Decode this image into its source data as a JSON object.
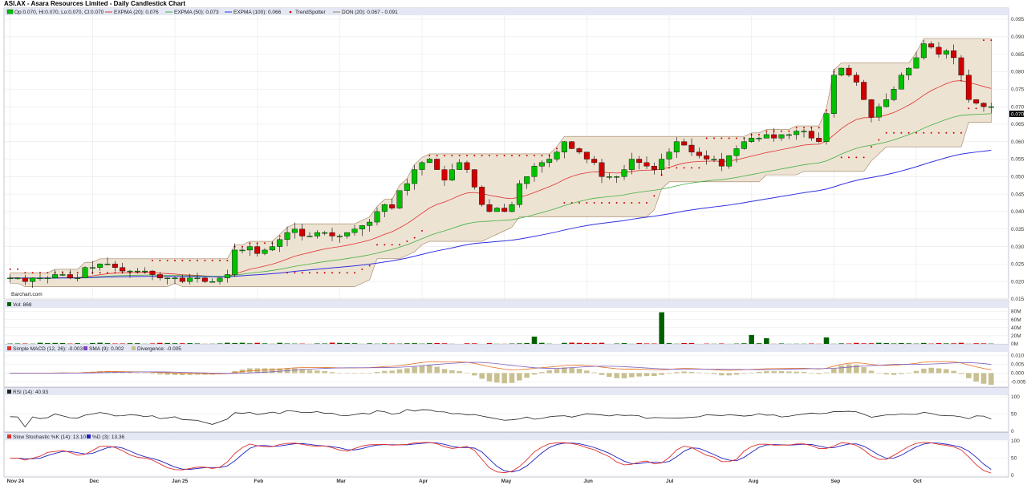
{
  "title": "ASI.AX - Asara Resources Limited - Daily Candlestick Chart",
  "watermark": "Barchart.com",
  "colors": {
    "up": "#00c000",
    "down": "#d00000",
    "ema20": "#e03030",
    "ema50": "#40b040",
    "ema100": "#3030e0",
    "donchian": "#a08060",
    "donchianFill": "#ede3d3",
    "trendspotter": "#d00000",
    "header": "#e4e8f4",
    "grid": "#e8e8e8"
  },
  "price_panel": {
    "legend": [
      {
        "key": "ohlc",
        "text": "Op:0.070, Hi:0.070, Lo:0.070, Cl:0.070"
      },
      {
        "key": "ema20",
        "text": "EXPMA (20): 0.076"
      },
      {
        "key": "ema50",
        "text": "EXPMA (50): 0.073"
      },
      {
        "key": "ema100",
        "text": "EXPMA (100): 0.066"
      },
      {
        "key": "trend",
        "text": "TrendSpotter"
      },
      {
        "key": "don",
        "text": "DON (20): 0.067 - 0.091"
      }
    ],
    "y_ticks": [
      "0.015",
      "0.020",
      "0.025",
      "0.030",
      "0.035",
      "0.040",
      "0.045",
      "0.050",
      "0.055",
      "0.060",
      "0.065",
      "0.070",
      "0.075",
      "0.080",
      "0.085",
      "0.090",
      "0.095"
    ],
    "last_price_label": "0.070"
  },
  "volume_panel": {
    "legend": "Vol: 868",
    "y_ticks": [
      "0M",
      "20M",
      "40M",
      "60M",
      "80M"
    ]
  },
  "macd_panel": {
    "legend": [
      {
        "key": "macd",
        "text": "Simple MACD (12, 26): -0.003"
      },
      {
        "key": "sma",
        "text": "SMA (9): 0.002"
      },
      {
        "key": "div",
        "text": "Divergence: -0.005"
      }
    ],
    "y_ticks": [
      "-0.005",
      "0.000",
      "0.005",
      "0.010"
    ]
  },
  "rsi_panel": {
    "legend": "RSI (14): 40.93",
    "y_ticks": [
      "0",
      "50",
      "100"
    ]
  },
  "stoch_panel": {
    "legend": [
      {
        "key": "k",
        "text": "Slow Stochastic %K (14): 13.10"
      },
      {
        "key": "d",
        "text": "%D (3): 13.36"
      }
    ],
    "y_ticks": [
      "0",
      "50",
      "100"
    ]
  },
  "x_months": [
    "Nov 24",
    "Dec",
    "Jan 25",
    "Feb",
    "Mar",
    "Apr",
    "May",
    "Jun",
    "Jul",
    "Aug",
    "Sep",
    "Oct"
  ],
  "chart_data": {
    "type": "candlestick",
    "x_labels": [
      "Nov 24",
      "Dec",
      "Jan 25",
      "Feb",
      "Mar",
      "Apr",
      "May",
      "Jun",
      "Jul",
      "Aug",
      "Sep",
      "Oct"
    ],
    "ylim": [
      0.015,
      0.095
    ],
    "close_approx": [
      0.021,
      0.021,
      0.02,
      0.021,
      0.021,
      0.021,
      0.022,
      0.022,
      0.021,
      0.021,
      0.024,
      0.024,
      0.025,
      0.025,
      0.024,
      0.023,
      0.023,
      0.023,
      0.023,
      0.022,
      0.021,
      0.021,
      0.021,
      0.02,
      0.021,
      0.021,
      0.02,
      0.02,
      0.021,
      0.022,
      0.029,
      0.029,
      0.03,
      0.028,
      0.029,
      0.03,
      0.032,
      0.034,
      0.035,
      0.033,
      0.033,
      0.034,
      0.034,
      0.033,
      0.033,
      0.034,
      0.035,
      0.036,
      0.037,
      0.04,
      0.042,
      0.041,
      0.046,
      0.048,
      0.052,
      0.054,
      0.055,
      0.052,
      0.049,
      0.052,
      0.054,
      0.052,
      0.047,
      0.042,
      0.04,
      0.041,
      0.04,
      0.042,
      0.048,
      0.05,
      0.053,
      0.054,
      0.055,
      0.057,
      0.06,
      0.058,
      0.057,
      0.055,
      0.054,
      0.05,
      0.05,
      0.05,
      0.052,
      0.055,
      0.054,
      0.053,
      0.052,
      0.055,
      0.057,
      0.06,
      0.059,
      0.057,
      0.056,
      0.055,
      0.055,
      0.053,
      0.056,
      0.058,
      0.06,
      0.061,
      0.061,
      0.062,
      0.061,
      0.062,
      0.062,
      0.063,
      0.063,
      0.061,
      0.06,
      0.068,
      0.079,
      0.081,
      0.079,
      0.077,
      0.072,
      0.067,
      0.07,
      0.072,
      0.075,
      0.079,
      0.081,
      0.084,
      0.088,
      0.087,
      0.085,
      0.086,
      0.084,
      0.079,
      0.072,
      0.071,
      0.07,
      0.07
    ],
    "volume_spikes_M": [
      {
        "month": "Jul",
        "value": 78
      }
    ],
    "indicators": {
      "EXPMA20": 0.076,
      "EXPMA50": 0.073,
      "EXPMA100": 0.066,
      "DON20": [
        0.067,
        0.091
      ],
      "MACD": -0.003,
      "SMA9": 0.002,
      "Divergence": -0.005,
      "RSI14": 40.93,
      "StochK": 13.1,
      "StochD": 13.36,
      "Vol": 868
    }
  }
}
